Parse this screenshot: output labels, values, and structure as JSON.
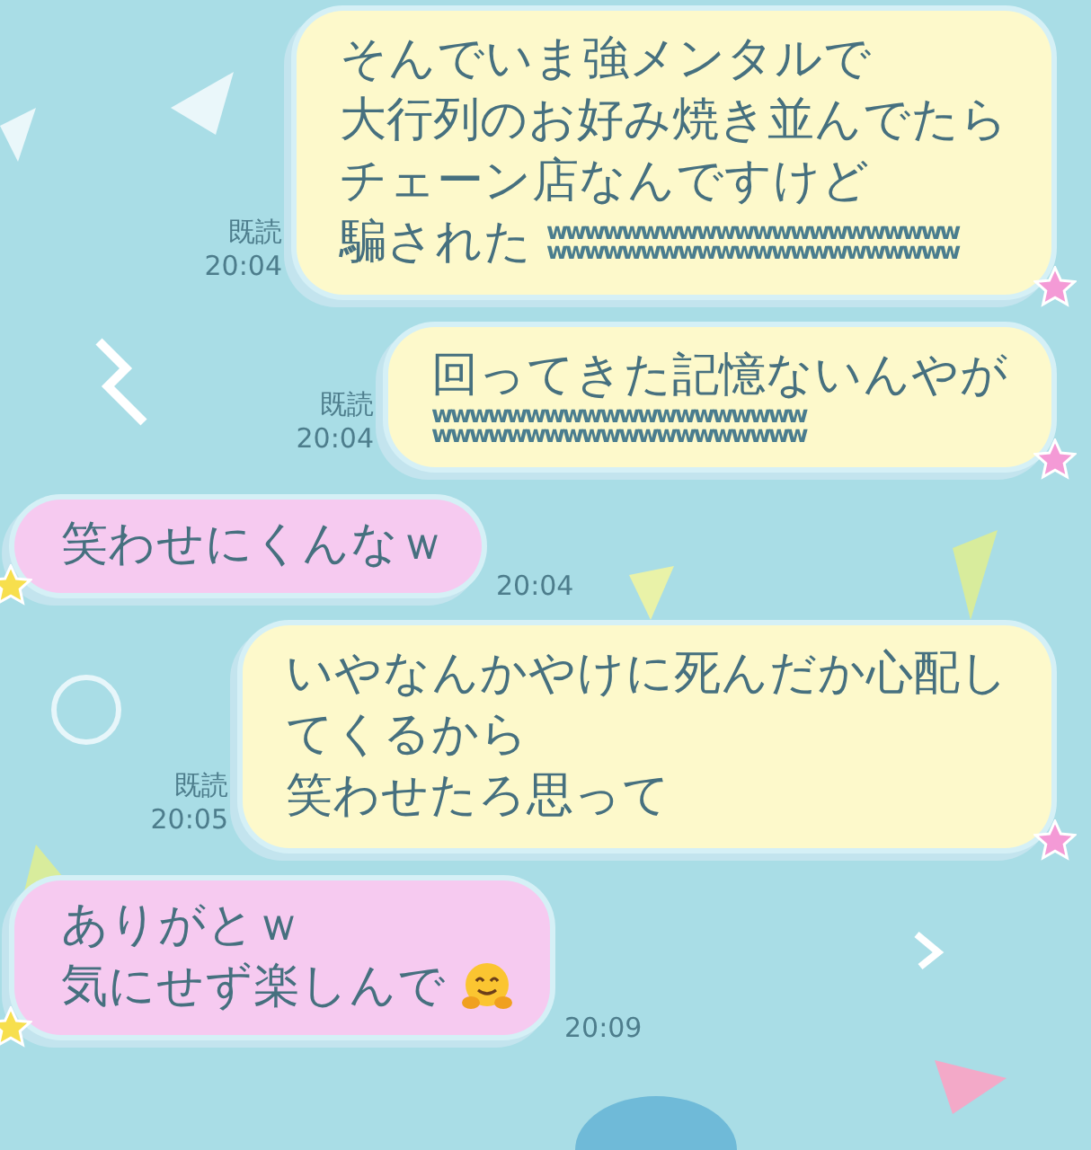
{
  "messages": [
    {
      "kind": "sent",
      "read": "既読",
      "time": "20:04",
      "lines": [
        {
          "text": "そんでいま強メンタルで"
        },
        {
          "text": "大行列のお好み焼き並んでたら"
        },
        {
          "text": "チェーン店なんですけど"
        },
        {
          "text": "騙された",
          "laugh": [
            "wwwwwwwwwwwwwwwwwwwwww",
            "wwwwwwwwwwwwwwwwwwwwww"
          ]
        }
      ]
    },
    {
      "kind": "sent",
      "read": "既読",
      "time": "20:04",
      "lines": [
        {
          "text": "回ってきた記憶ないんやが"
        },
        {
          "laugh": [
            "wwwwwwwwwwwwwwwwwwww",
            "wwwwwwwwwwwwwwwwwwww"
          ]
        }
      ]
    },
    {
      "kind": "received",
      "time": "20:04",
      "lines": [
        {
          "text": "笑わせにくんなｗ"
        }
      ]
    },
    {
      "kind": "sent",
      "read": "既読",
      "time": "20:05",
      "lines": [
        {
          "text": "いやなんかやけに死んだか心配し"
        },
        {
          "text": "てくるから"
        },
        {
          "text": "笑わせたろ思って"
        }
      ]
    },
    {
      "kind": "received",
      "time": "20:09",
      "lines": [
        {
          "text": "ありがとｗ"
        },
        {
          "text": "気にせず楽しんで",
          "emoji": true
        }
      ]
    }
  ]
}
